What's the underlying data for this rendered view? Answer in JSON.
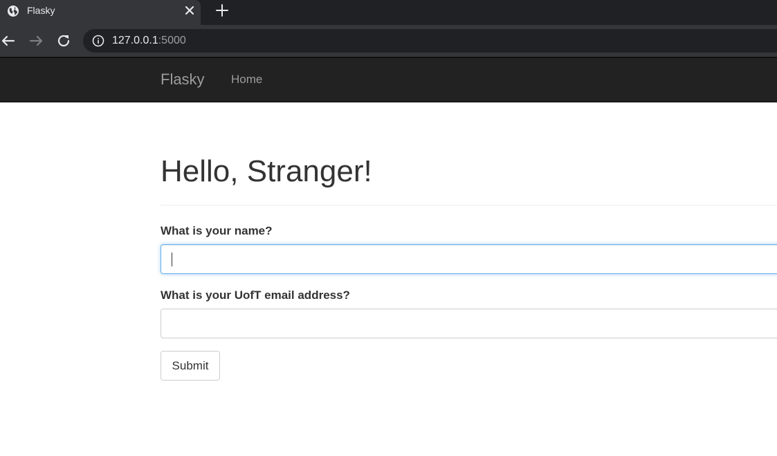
{
  "browser": {
    "tab": {
      "title": "Flasky",
      "favicon": "globe-icon"
    },
    "url": {
      "host": "127.0.0.1",
      "port": ":5000"
    },
    "icons": {
      "back": "arrow-left-icon",
      "forward": "arrow-right-icon",
      "reload": "reload-icon",
      "site_info": "info-icon",
      "close_tab": "close-icon",
      "new_tab": "plus-icon"
    }
  },
  "navbar": {
    "brand": "Flasky",
    "links": [
      {
        "label": "Home"
      }
    ]
  },
  "main": {
    "heading": "Hello, Stranger!",
    "form": {
      "name_label": "What is your name?",
      "name_value": "",
      "email_label": "What is your UofT email address?",
      "email_value": "",
      "submit_label": "Submit"
    }
  },
  "colors": {
    "navbar_bg": "#222222",
    "navbar_text": "#9d9d9d",
    "focus_border": "#66afe9",
    "chrome_bg": "#35363a",
    "tabstrip_bg": "#202124"
  }
}
